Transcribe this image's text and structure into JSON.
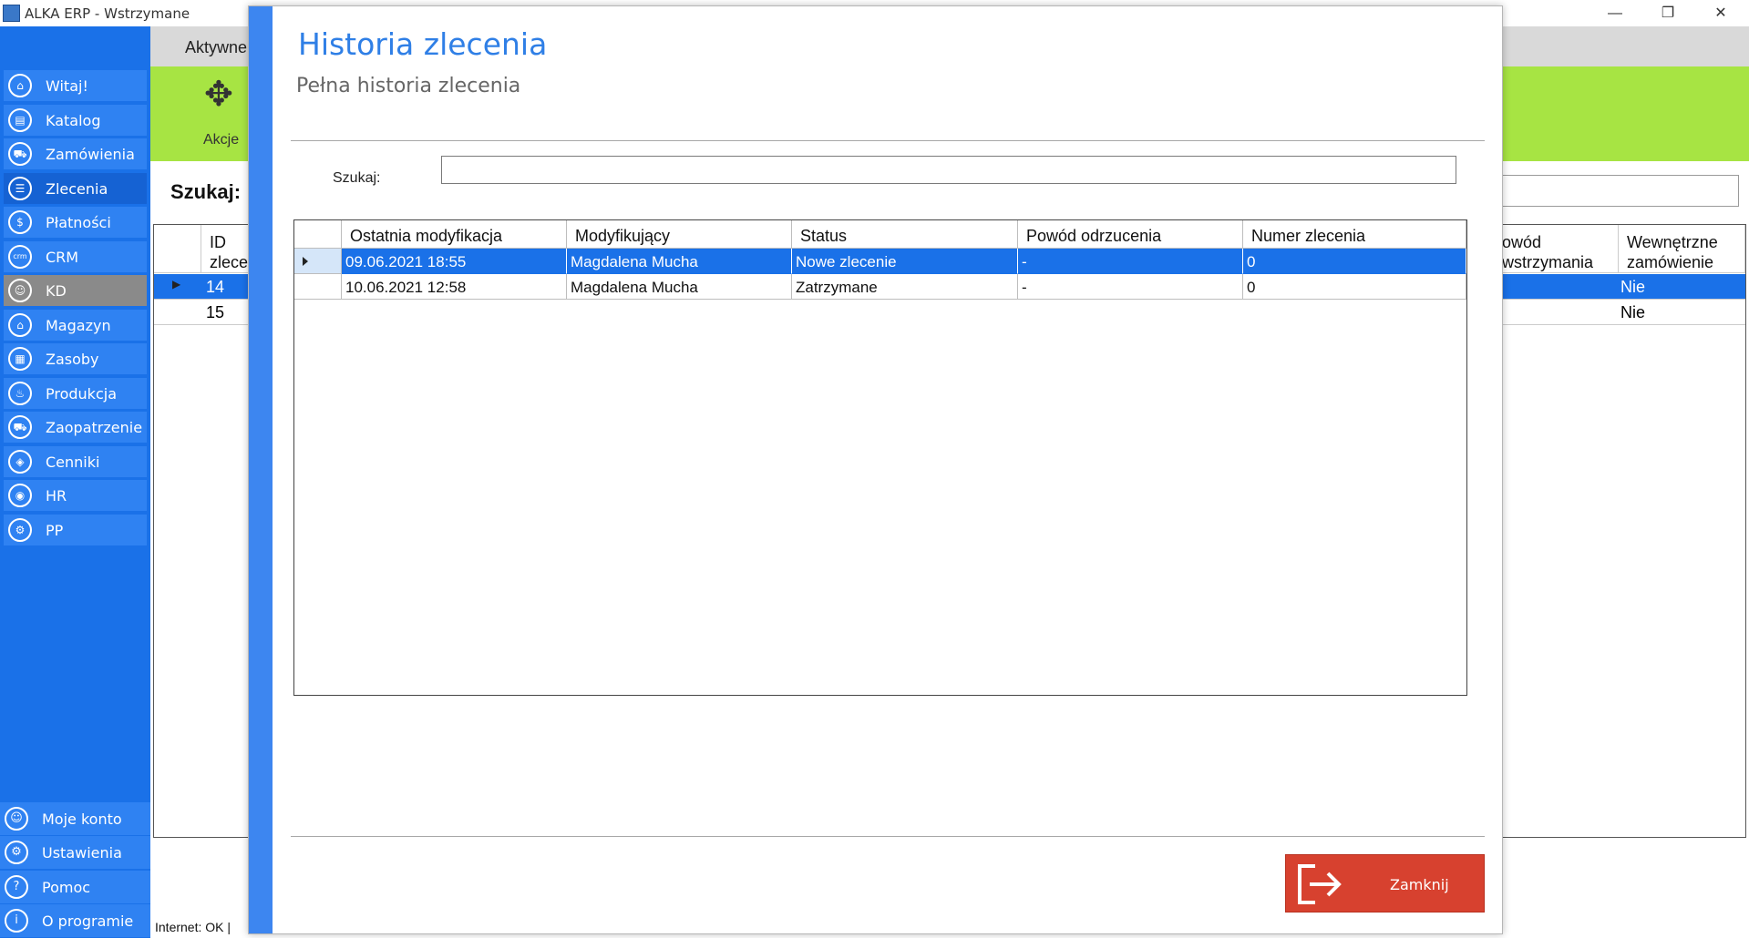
{
  "window": {
    "title": "ALKA ERP - Wstrzymane",
    "minimize": "—",
    "restore": "❐",
    "close": "✕"
  },
  "sidebar": {
    "items": [
      {
        "label": "Witaj!",
        "icon": "home-icon",
        "glyph": "⌂"
      },
      {
        "label": "Katalog",
        "icon": "book-icon",
        "glyph": "▤"
      },
      {
        "label": "Zamówienia",
        "icon": "cart-icon",
        "glyph": "⛟"
      },
      {
        "label": "Zlecenia",
        "icon": "list-icon",
        "glyph": "☰"
      },
      {
        "label": "Płatności",
        "icon": "dollar-icon",
        "glyph": "$"
      },
      {
        "label": "CRM",
        "icon": "crm-icon",
        "glyph": "crm"
      },
      {
        "label": "KD",
        "icon": "user-lock-icon",
        "glyph": "☺"
      },
      {
        "label": "Magazyn",
        "icon": "warehouse-icon",
        "glyph": "⌂"
      },
      {
        "label": "Zasoby",
        "icon": "resources-icon",
        "glyph": "▦"
      },
      {
        "label": "Produkcja",
        "icon": "production-icon",
        "glyph": "♨"
      },
      {
        "label": "Zaopatrzenie",
        "icon": "truck-icon",
        "glyph": "⛟"
      },
      {
        "label": "Cenniki",
        "icon": "tag-icon",
        "glyph": "◈"
      },
      {
        "label": "HR",
        "icon": "hr-icon",
        "glyph": "◉"
      },
      {
        "label": "PP",
        "icon": "pp-icon",
        "glyph": "⚙"
      }
    ],
    "bottom": [
      {
        "label": "Moje konto",
        "icon": "account-icon",
        "glyph": "☺"
      },
      {
        "label": "Ustawienia",
        "icon": "settings-icon",
        "glyph": "⚙"
      },
      {
        "label": "Pomoc",
        "icon": "help-icon",
        "glyph": "?"
      },
      {
        "label": "O programie",
        "icon": "info-icon",
        "glyph": "i"
      }
    ]
  },
  "background": {
    "tab": "Aktywne",
    "akcje": "Akcje",
    "search_label": "Szukaj:",
    "grid": {
      "headers": [
        "ID\nzlece",
        "owód\nwstrzymania",
        "Wewnętrzne\nzamówienie"
      ],
      "rows": [
        {
          "id": "14",
          "wewn": "Nie"
        },
        {
          "id": "15",
          "wewn": "Nie"
        }
      ]
    },
    "status": "Internet: OK  |"
  },
  "modal": {
    "title": "Historia zlecenia",
    "subtitle": "Pełna historia zlecenia",
    "search_label": "Szukaj:",
    "search_value": "",
    "columns": [
      "Ostatnia modyfikacja",
      "Modyfikujący",
      "Status",
      "Powód odrzucenia",
      "Numer zlecenia"
    ],
    "rows": [
      [
        "09.06.2021 18:55",
        "Magdalena Mucha",
        "Nowe zlecenie",
        "-",
        "0"
      ],
      [
        "10.06.2021 12:58",
        "Magdalena Mucha",
        "Zatrzymane",
        "-",
        "0"
      ]
    ],
    "selected_row": 0,
    "close_label": "Zamknij"
  },
  "colors": {
    "sidebar": "#1a71e8",
    "accent_blue": "#3d86f0",
    "toolbar_green": "#a7e443",
    "close_red": "#d7412f",
    "selection": "#1a71e8"
  }
}
